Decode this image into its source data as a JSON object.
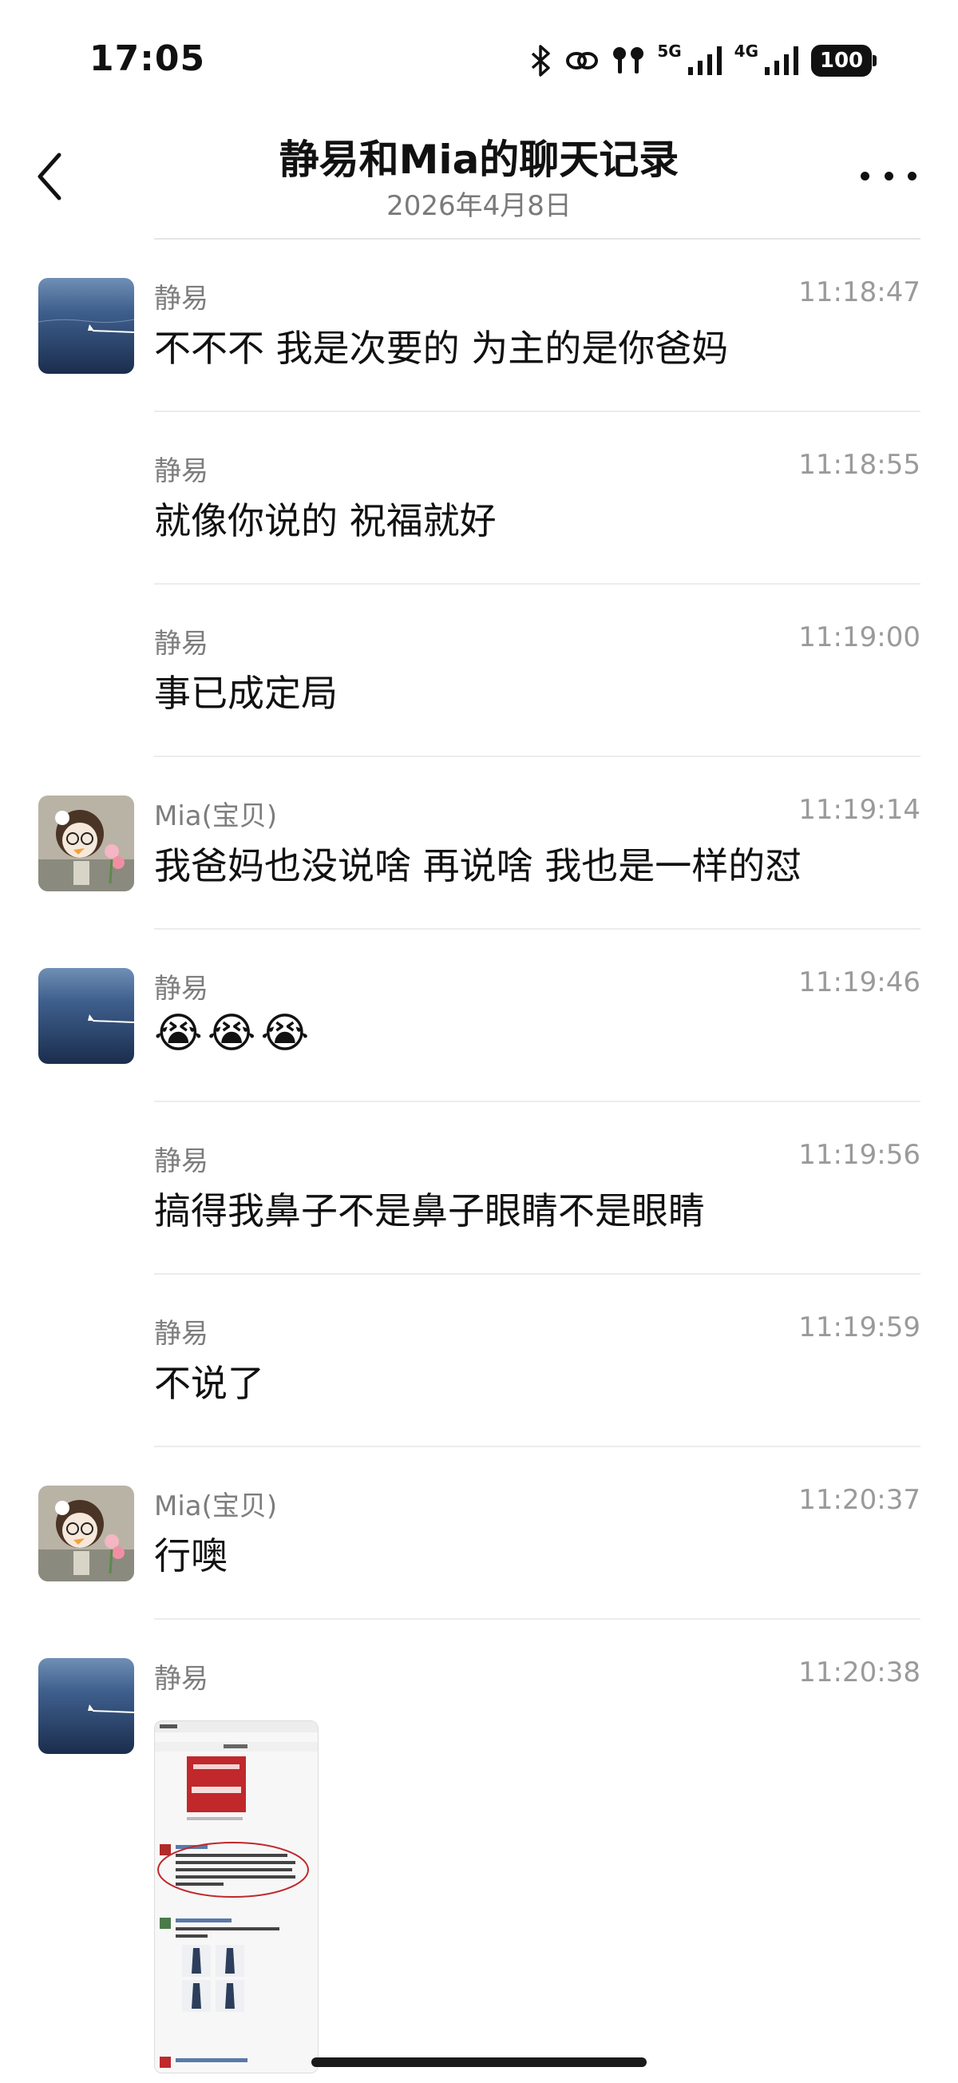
{
  "status_bar": {
    "time": "17:05",
    "net_5g": "5G",
    "net_4g": "4G",
    "battery": "100",
    "icons": [
      "bluetooth-icon",
      "link-icon",
      "earbuds-icon",
      "signal-5g-icon",
      "signal-4g-icon",
      "battery-icon"
    ]
  },
  "header": {
    "title": "静易和Mia的聊天记录",
    "date": "2026年4月8日",
    "back_icon": "chevron-left-icon",
    "more_icon": "more-dots-icon"
  },
  "messages": [
    {
      "sender": "静易",
      "time": "11:18:47",
      "text": "不不不 我是次要的 为主的是你爸妈",
      "avatar": "ocean-avatar"
    },
    {
      "sender": "静易",
      "time": "11:18:55",
      "text": "就像你说的 祝福就好"
    },
    {
      "sender": "静易",
      "time": "11:19:00",
      "text": "事已成定局"
    },
    {
      "sender": "Mia(宝贝)",
      "time": "11:19:14",
      "text": "我爸妈也没说啥 再说啥 我也是一样的怼",
      "avatar": "doll-avatar"
    },
    {
      "sender": "静易",
      "time": "11:19:46",
      "emojis": [
        "😭",
        "😭",
        "😭"
      ],
      "avatar": "ocean-avatar"
    },
    {
      "sender": "静易",
      "time": "11:19:56",
      "text": "搞得我鼻子不是鼻子眼睛不是眼睛"
    },
    {
      "sender": "静易",
      "time": "11:19:59",
      "text": "不说了"
    },
    {
      "sender": "Mia(宝贝)",
      "time": "11:20:37",
      "text": "行噢",
      "avatar": "doll-avatar"
    },
    {
      "sender": "静易",
      "time": "11:20:38",
      "type": "image",
      "avatar": "ocean-avatar"
    }
  ],
  "colors": {
    "text": "#111111",
    "meta": "#7d7d7d",
    "divider": "#ececec",
    "background": "#ffffff"
  }
}
